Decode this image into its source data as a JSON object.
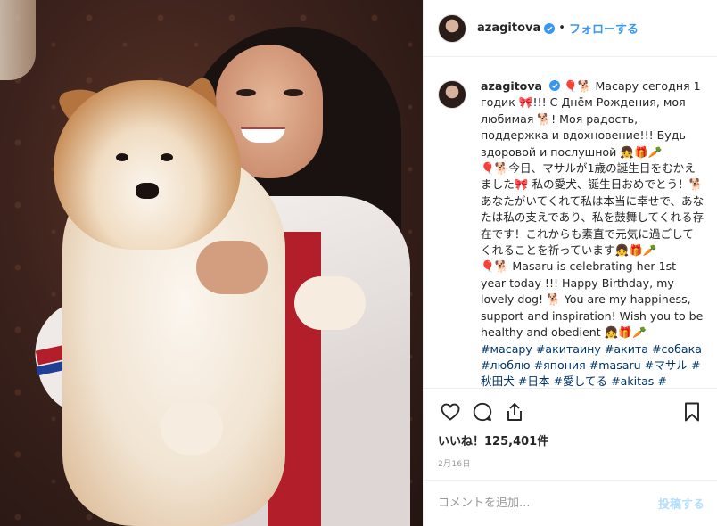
{
  "post": {
    "username": "azagitova",
    "follow_label": "フォローする",
    "dot": "•",
    "caption": {
      "ru": "🎈🐕 Масару сегодня 1 годик 🎀!!! С Днём Рождения, моя любимая 🐕! Моя радость, поддержка и вдохновение!!! Будь здоровой и послушной 👧🎁🥕",
      "ja": "🎈🐕今日、マサルが1歳の誕生日をむかえました🎀 私の愛犬、誕生日おめでとう！🐕あなたがいてくれて私は本当に幸せで、あなたは私の支えであり、私を鼓舞してくれる存在です！これからも素直で元気に過ごしてくれることを祈っています👧🎁🥕",
      "en": "🎈🐕 Masaru is celebrating her 1st year today !!! Happy Birthday, my lovely dog! 🐕 You are my happiness, support and inspiration! Wish you to be healthy and obedient 👧🎁🥕",
      "hashtags": "#масару #акитаину #акита #собака #люблю #япония #masaru #マサル #秋田犬 #日本 #愛してる #akitas #"
    },
    "likes_label": "いいね！125,401件",
    "date": "2月16日",
    "comment_placeholder": "コメントを追加...",
    "post_label": "投稿する",
    "accent_color": "#3897f0"
  },
  "icons": {
    "like": "heart-icon",
    "comment": "comment-icon",
    "share": "share-icon",
    "save": "bookmark-icon",
    "verified": "verified-badge-icon"
  }
}
